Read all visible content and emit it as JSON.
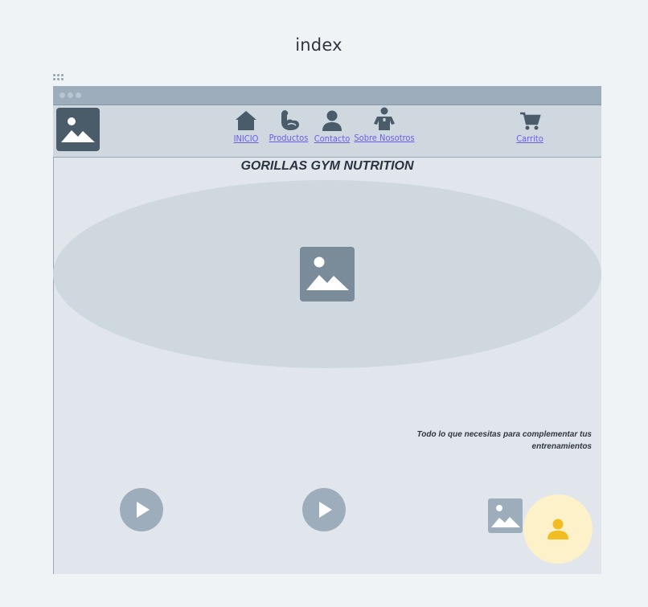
{
  "page": {
    "title": "index"
  },
  "nav": {
    "items": [
      {
        "label": "INICIO",
        "icon": "home-icon"
      },
      {
        "label": "Productos",
        "icon": "muscle-arm-icon"
      },
      {
        "label": "Contacto",
        "icon": "user-icon"
      },
      {
        "label": "Sobre Nosotros",
        "icon": "staff-person-icon"
      }
    ],
    "cart": {
      "label": "Carrito",
      "icon": "cart-icon"
    }
  },
  "main": {
    "brand": "GORILLAS GYM NUTRITION",
    "tagline": "Todo lo que necesitas para complementar tus entrenamientos"
  },
  "colors": {
    "page_background": "#f0f3f6",
    "frame_background": "#e1e6ec",
    "navbar_background": "#cfd8df",
    "link": "#6a5cf0",
    "placeholder_dark": "#4a5b6a",
    "placeholder_light": "#9dadbb",
    "user_fab_background": "#fdf1c9",
    "user_fab_icon": "#f2bd22"
  }
}
